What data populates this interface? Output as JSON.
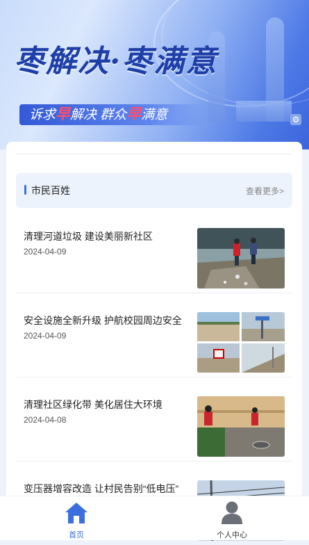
{
  "banner": {
    "title": "枣解决·枣满意",
    "subtitle_parts": [
      "诉求",
      "早",
      "解决  群众",
      "早",
      "满意"
    ]
  },
  "section": {
    "name": "市民百姓",
    "more_label": "查看更多>"
  },
  "news": [
    {
      "title": "清理河道垃圾  建设美丽新社区",
      "date": "2024-04-09",
      "image": "river-cleanup-photo"
    },
    {
      "title": "安全设施全新升级  护航校园周边安全",
      "date": "2024-04-09",
      "image": "road-safety-collage-photo"
    },
    {
      "title": "清理社区绿化带  美化居住大环境",
      "date": "2024-04-08",
      "image": "community-greenbelt-photo"
    },
    {
      "title": "变压器增容改造  让村民告别“低电压”",
      "date": "",
      "image": "power-line-photo"
    }
  ],
  "tabbar": {
    "home_label": "首页",
    "profile_label": "个人中心",
    "active_color": "#3b6fe0",
    "inactive_color": "#555555"
  }
}
